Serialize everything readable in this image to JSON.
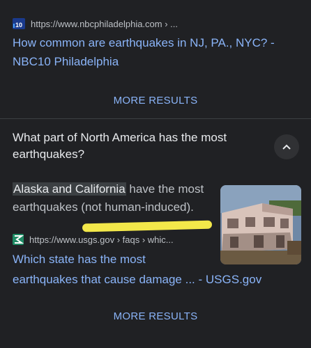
{
  "result1": {
    "source_url": "https://www.nbcphiladelphia.com › ...",
    "favicon": "nbc10-icon",
    "title_line1": "How common are earthquakes in NJ, PA., NYC? -",
    "title_line2": "NBC10 Philadelphia"
  },
  "more_results_1": "MORE RESULTS",
  "question": {
    "line1": "What part of North America has the most",
    "line2": "earthquakes?"
  },
  "answer": {
    "highlight": "Alaska and California",
    "rest_line1": " have the most",
    "line2": "earthquakes (not human-induced)."
  },
  "result2": {
    "source_url": "https://www.usgs.gov › faqs › whic...",
    "favicon": "usgs-icon",
    "title_line1": "Which state has the most",
    "title_line2": "earthquakes that cause damage ... - USGS.gov"
  },
  "more_results_2": "MORE RESULTS",
  "colors": {
    "background": "#202124",
    "link": "#8ab4f8",
    "marker": "#f3e84a"
  }
}
